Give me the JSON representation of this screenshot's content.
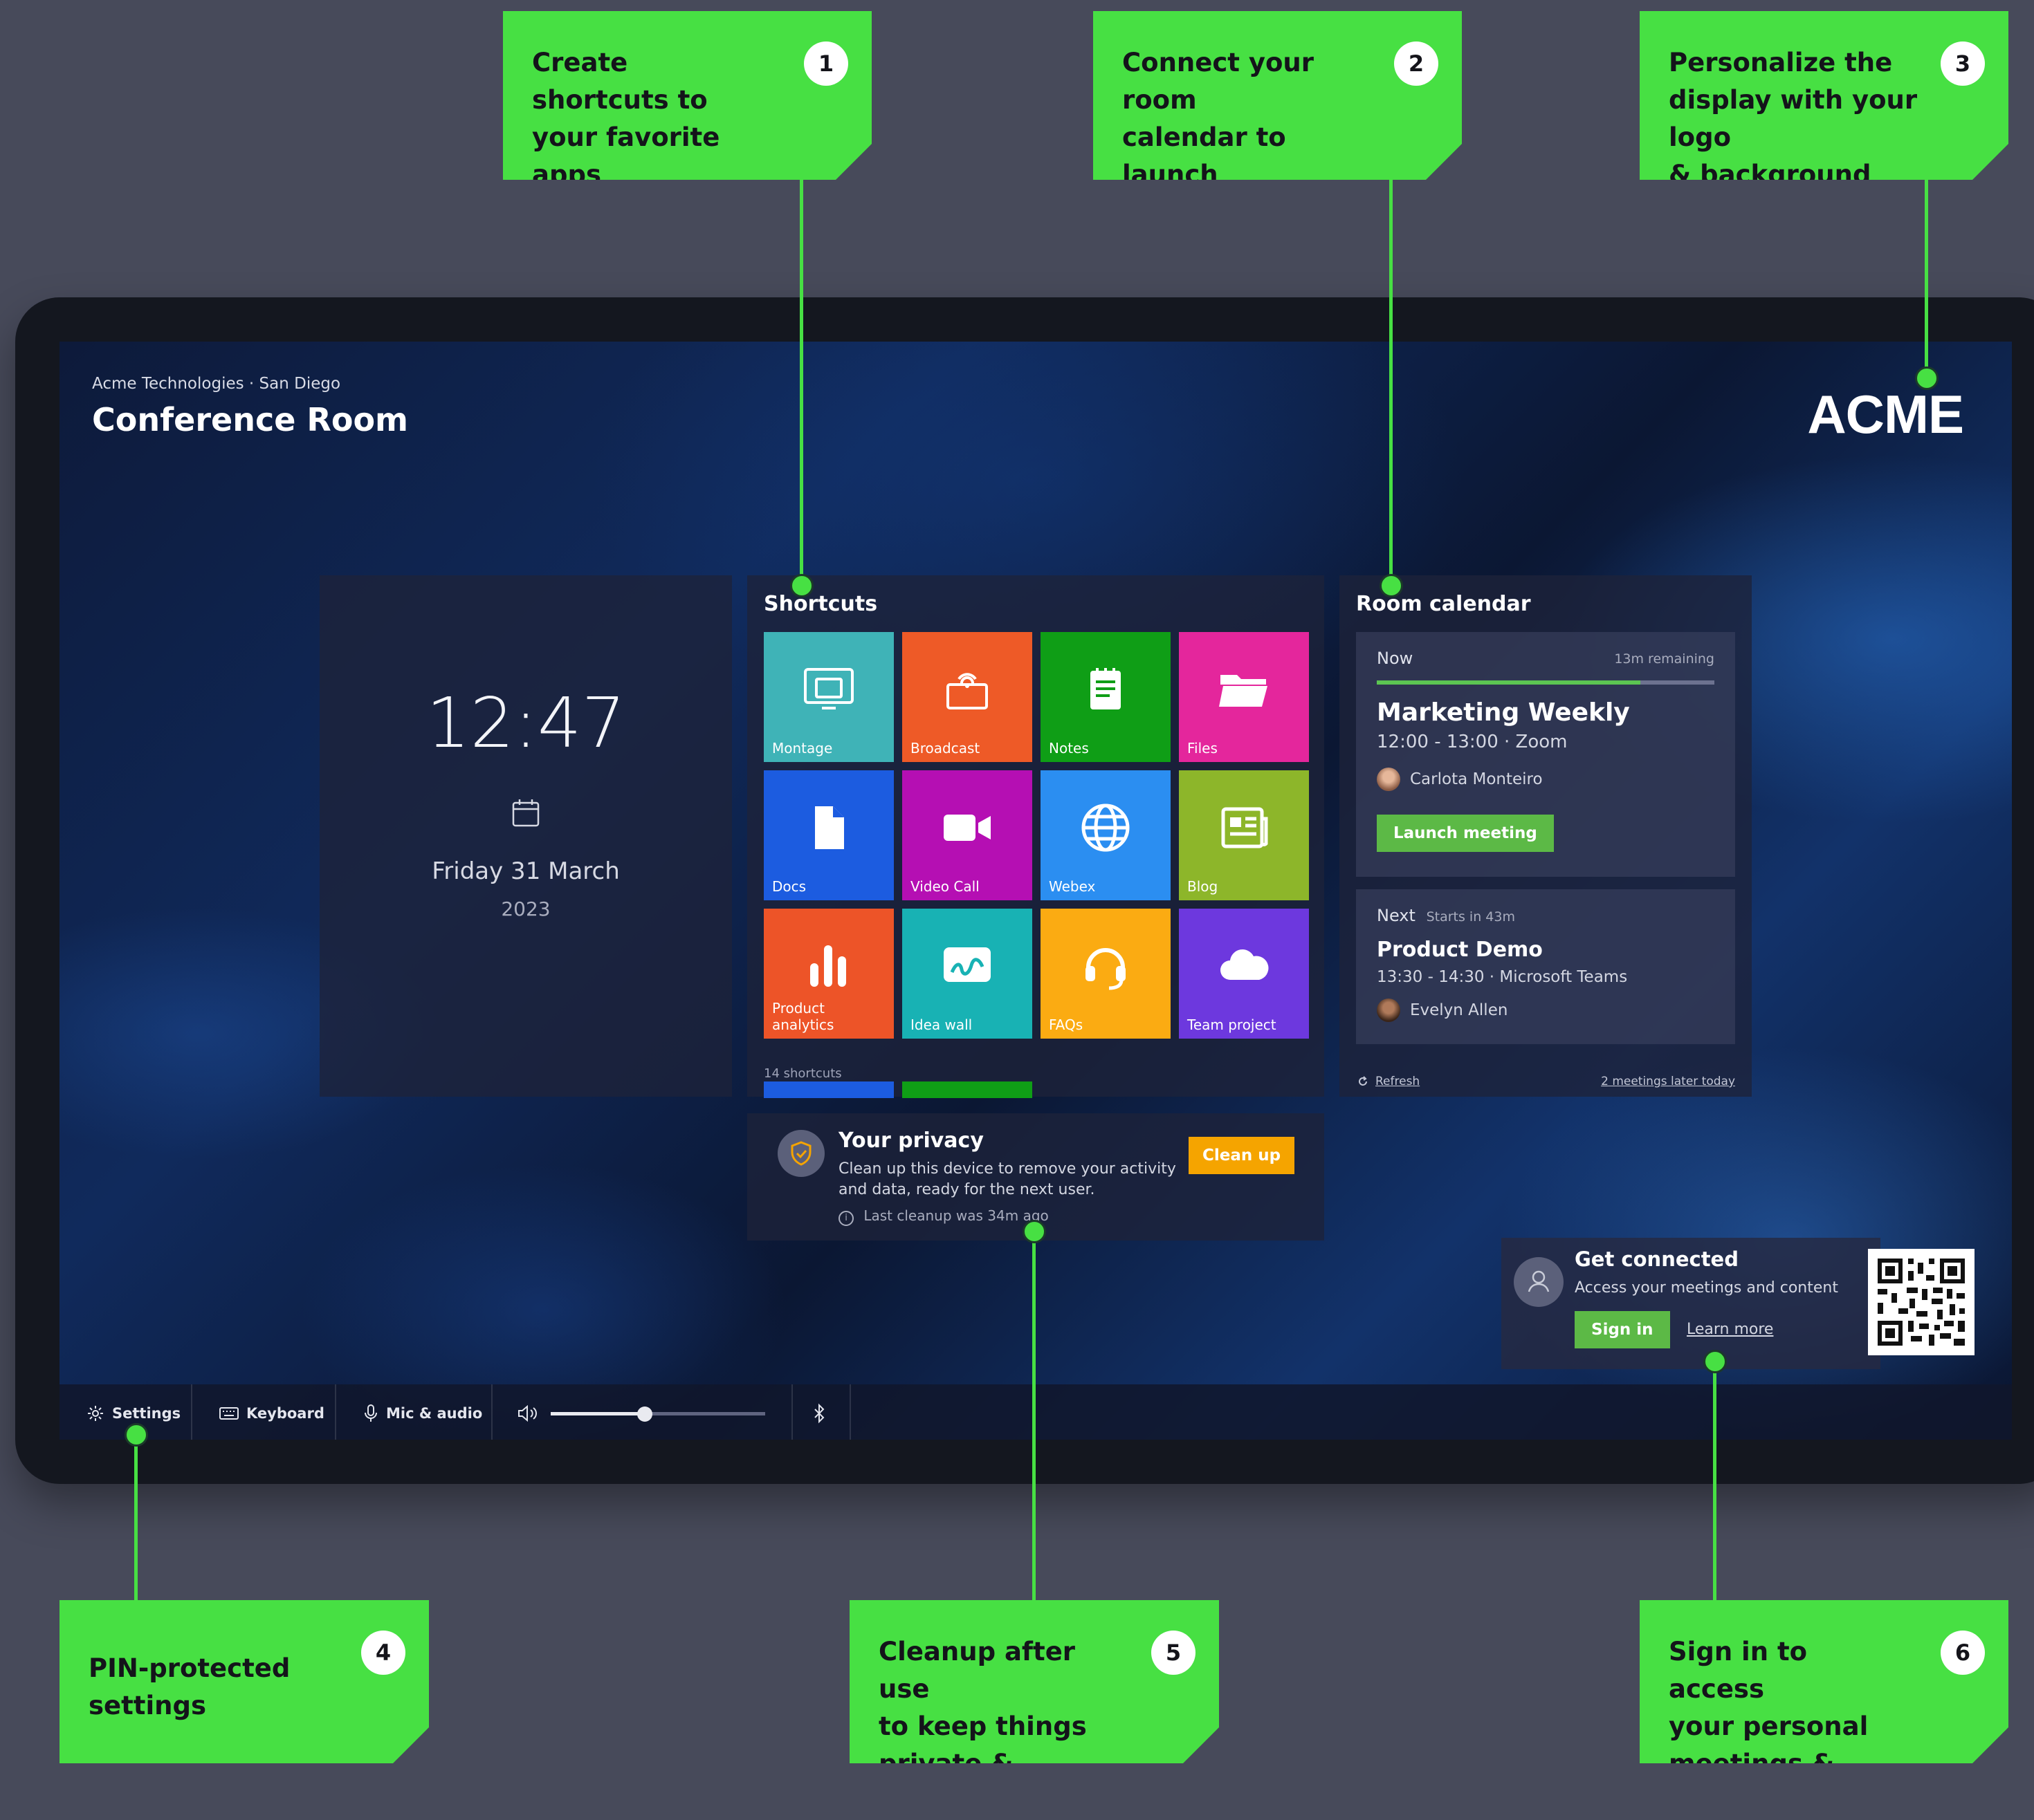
{
  "callouts": [
    {
      "num": "1",
      "text": "Create shortcuts to\nyour favorite apps\n& websites"
    },
    {
      "num": "2",
      "text": "Connect your room\ncalendar to launch\ncalls with ease"
    },
    {
      "num": "3",
      "text": "Personalize the\ndisplay with your logo\n& background"
    },
    {
      "num": "4",
      "text": "PIN-protected\nsettings"
    },
    {
      "num": "5",
      "text": "Cleanup after use\nto keep things\nprivate & secure"
    },
    {
      "num": "6",
      "text": "Sign in to access\nyour personal\nmeetings & files"
    }
  ],
  "header": {
    "org": "Acme Technologies · San Diego",
    "room": "Conference Room",
    "logo": "ACME"
  },
  "clock": {
    "time": "12:47",
    "date": "Friday 31 March",
    "year": "2023"
  },
  "shortcuts": {
    "title": "Shortcuts",
    "count": "14 shortcuts",
    "tiles": [
      {
        "label": "Montage",
        "color": "#3fb3b7",
        "icon": "montage-icon"
      },
      {
        "label": "Broadcast",
        "color": "#ee5a27",
        "icon": "broadcast-icon"
      },
      {
        "label": "Notes",
        "color": "#0f9e16",
        "icon": "notes-icon"
      },
      {
        "label": "Files",
        "color": "#e4269c",
        "icon": "folder-icon"
      },
      {
        "label": "Docs",
        "color": "#1c5ce0",
        "icon": "document-icon"
      },
      {
        "label": "Video Call",
        "color": "#b50fb3",
        "icon": "video-camera-icon"
      },
      {
        "label": "Webex",
        "color": "#2b8ef1",
        "icon": "globe-icon"
      },
      {
        "label": "Blog",
        "color": "#8db62a",
        "icon": "newspaper-icon"
      },
      {
        "label": "Product analytics",
        "color": "#ed5428",
        "icon": "bar-chart-icon"
      },
      {
        "label": "Idea wall",
        "color": "#18b2b4",
        "icon": "whiteboard-icon"
      },
      {
        "label": "FAQs",
        "color": "#fbab12",
        "icon": "headset-icon"
      },
      {
        "label": "Team project",
        "color": "#6d38de",
        "icon": "cloud-icon"
      }
    ]
  },
  "calendar": {
    "title": "Room calendar",
    "now": {
      "label": "Now",
      "remaining": "13m remaining",
      "progress": 0.78,
      "title": "Marketing Weekly",
      "time": "12:00 - 13:00 · Zoom",
      "organizer": "Carlota Monteiro",
      "button": "Launch meeting"
    },
    "next": {
      "label": "Next",
      "starts": "Starts in 43m",
      "title": "Product Demo",
      "time": "13:30 - 14:30 · Microsoft Teams",
      "organizer": "Evelyn Allen"
    },
    "refresh": "Refresh",
    "later": "2 meetings later today"
  },
  "privacy": {
    "title": "Your privacy",
    "body": "Clean up this device to remove your activity and data, ready for the next user.",
    "last": "Last cleanup was 34m ago",
    "button": "Clean up"
  },
  "connect": {
    "title": "Get connected",
    "body": "Access your meetings and content",
    "signin": "Sign in",
    "learn": "Learn more"
  },
  "bottombar": {
    "settings": "Settings",
    "keyboard": "Keyboard",
    "mic": "Mic & audio",
    "volume": 0.44
  },
  "colors": {
    "accent": "#47e043",
    "launch": "#5cb946",
    "cleanup": "#f5a400"
  }
}
